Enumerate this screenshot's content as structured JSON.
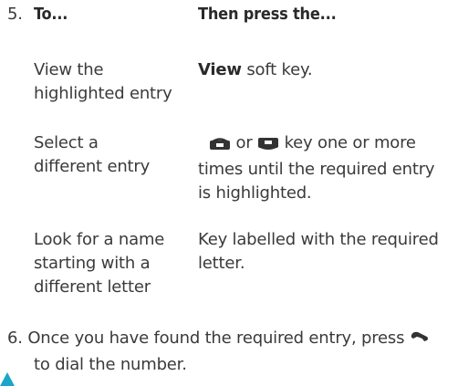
{
  "step5": {
    "number": "5.",
    "col1_header": "To...",
    "col2_header": "Then press the...",
    "rows": [
      {
        "action": [
          "View the",
          "highlighted entry"
        ],
        "instruction_bold": "View",
        "instruction_text": " soft key."
      },
      {
        "action": [
          "Select a",
          "different entry"
        ],
        "instruction_mid": " or ",
        "instruction_line1_end": " key one or more",
        "instruction_lines": [
          "times until the required entry",
          "is highlighted."
        ]
      },
      {
        "action": [
          "Look for a name",
          "starting with a",
          "different letter"
        ],
        "instruction_lines": [
          "Key labelled with the required",
          "letter."
        ]
      }
    ]
  },
  "step6": {
    "number": "6.",
    "line1": "Once you have found the required entry, press",
    "line2": "to dial the number."
  },
  "icons": [
    "up-key-icon",
    "down-key-icon",
    "send-key-icon",
    "page-marker-triangle"
  ],
  "colors": {
    "text": "#3a3a3a",
    "marker": "#1ba6c8"
  }
}
